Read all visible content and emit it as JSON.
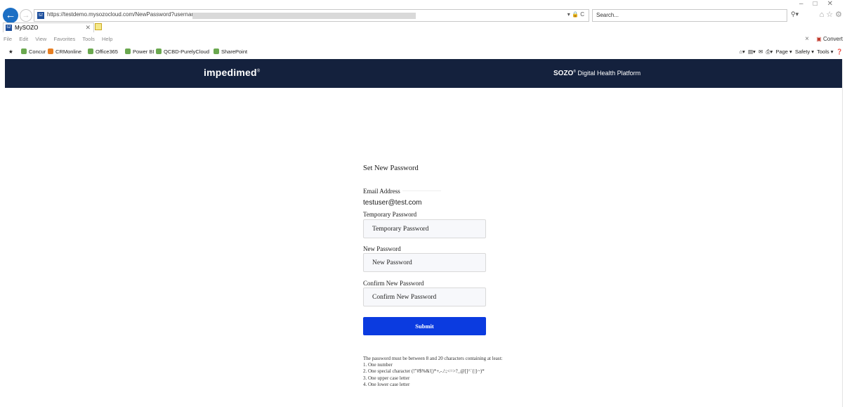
{
  "browser": {
    "url": "https://testdemo.mysozocloud.com/NewPassword?usernam",
    "addr_tools": "▾ 🔒 C",
    "search_placeholder": "Search...",
    "tab_title": "MySOZO",
    "menu": [
      "File",
      "Edit",
      "View",
      "Favorites",
      "Tools",
      "Help"
    ],
    "convert_label": "Convert",
    "favorites": [
      "Concur",
      "CRMonline",
      "Office365",
      "Power BI",
      "QCBD-PurelyCloud",
      "SharePoint"
    ],
    "command_bar": [
      "Page ▾",
      "Safety ▾",
      "Tools ▾"
    ],
    "accent_color": "#1c6fc4"
  },
  "header": {
    "brand": "impedimed",
    "platform_prefix": "SOZO",
    "platform_suffix": "Digital Health Platform",
    "background": "#14213d"
  },
  "form": {
    "title": "Set New Password",
    "email_label": "Email Address",
    "email_value": "testuser@test.com",
    "temp_password_label": "Temporary Password",
    "temp_password_placeholder": "Temporary Password",
    "new_password_label": "New Password",
    "new_password_placeholder": "New Password",
    "confirm_password_label": "Confirm New Password",
    "confirm_password_placeholder": "Confirm New Password",
    "submit_label": "Submit",
    "submit_color": "#0b3be0"
  },
  "rules": {
    "intro": "The password must be between 8 and 20 characters containing at least:",
    "items": [
      "1. One number",
      "2. One special character (!\"#$%&'()*+,-./:;<=>?_@[]^`{|}~)*",
      "3. One upper case letter",
      "4. One lower case letter"
    ]
  }
}
